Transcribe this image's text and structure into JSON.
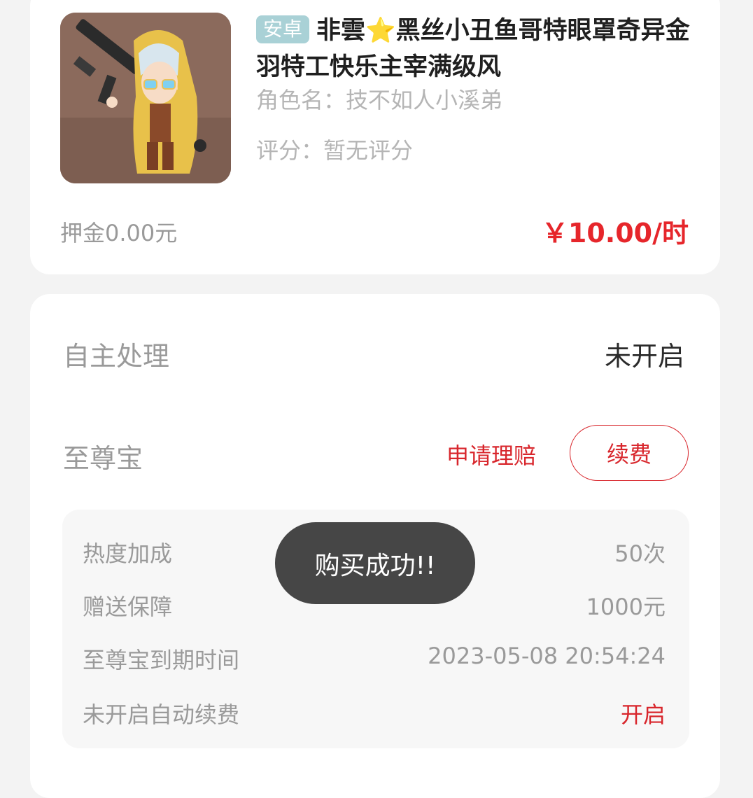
{
  "listing": {
    "platform_tag": "安卓",
    "title": "非雲⭐黑丝小丑鱼哥特眼罩奇异金羽特工快乐主宰满级风",
    "role_name": "角色名：技不如人小溪弟",
    "rating": "评分：暂无评分",
    "deposit": "押金0.00元",
    "price": "￥10.00/时"
  },
  "settings": {
    "self_handle_label": "自主处理",
    "self_handle_value": "未开启",
    "vip_label": "至尊宝",
    "claim_label": "申请理赔",
    "renew_label": "续费"
  },
  "details": [
    {
      "label": "热度加成",
      "value": "50次"
    },
    {
      "label": "赠送保障",
      "value": "1000元"
    },
    {
      "label": "至尊宝到期时间",
      "value": "2023-05-08 20:54:24"
    },
    {
      "label": "未开启自动续费",
      "value": "开启"
    }
  ],
  "toast": "购买成功!!",
  "colors": {
    "accent_red": "#d8262c",
    "price_red": "#e6262b",
    "tag_teal": "#a9d1d6",
    "toast_bg": "#464646"
  }
}
